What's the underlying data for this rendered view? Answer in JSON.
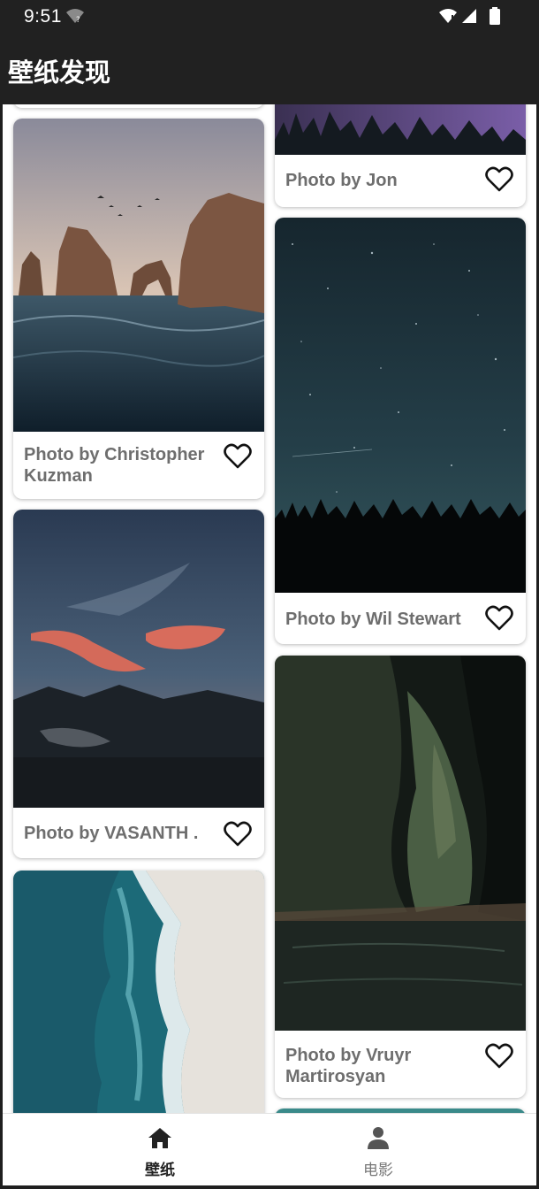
{
  "status_bar": {
    "time": "9:51"
  },
  "app_bar": {
    "title": "壁纸发现"
  },
  "cards": [
    {
      "caption": "Photo by Jon",
      "liked": false
    },
    {
      "caption": "Photo by Christopher Kuzman",
      "liked": false
    },
    {
      "caption": "Photo by Wil Stewart",
      "liked": false
    },
    {
      "caption": "Photo by VASANTH .",
      "liked": false
    },
    {
      "caption": "Photo by Vruyr Martirosyan",
      "liked": false
    }
  ],
  "bottom_nav": {
    "items": [
      {
        "label": "壁纸",
        "icon": "home-icon",
        "active": true
      },
      {
        "label": "电影",
        "icon": "person-icon",
        "active": false
      }
    ]
  },
  "colors": {
    "app_bar": "#212121",
    "caption_text": "#6e6e6e",
    "active_nav": "#222222",
    "inactive_nav": "#777777"
  }
}
